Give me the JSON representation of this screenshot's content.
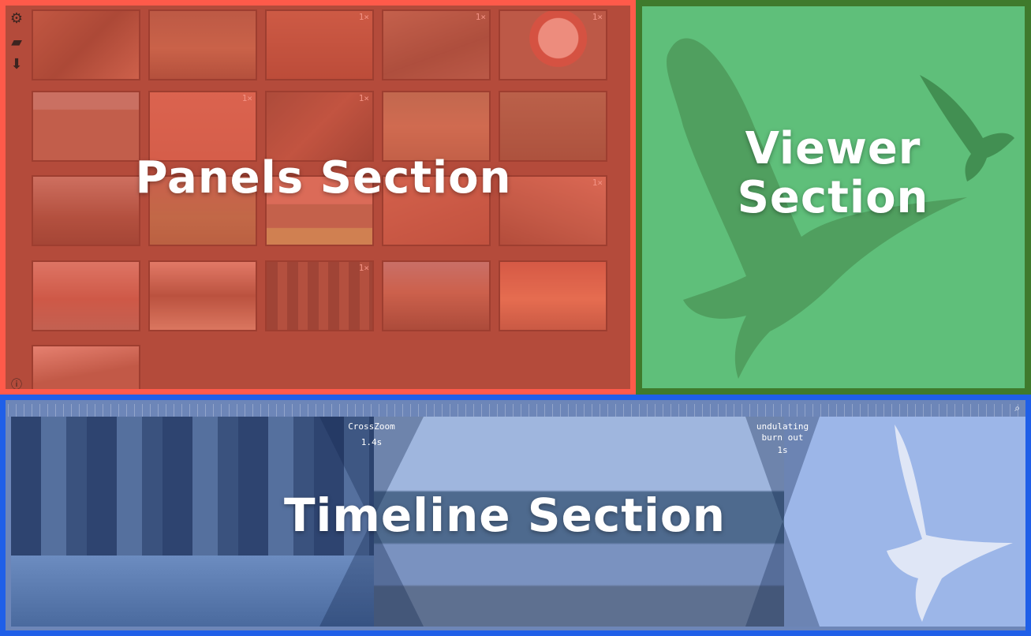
{
  "panels": {
    "label": "Panels Section",
    "tools": [
      "gear-icon",
      "folder-open-icon",
      "download-icon"
    ],
    "thumbnails": [
      {
        "rate": ""
      },
      {
        "rate": ""
      },
      {
        "rate": "1×"
      },
      {
        "rate": "1×"
      },
      {
        "rate": "1×"
      },
      {
        "rate": ""
      },
      {
        "rate": "1×"
      },
      {
        "rate": "1×"
      },
      {
        "rate": ""
      },
      {
        "rate": ""
      },
      {
        "rate": ""
      },
      {
        "rate": ""
      },
      {
        "rate": ""
      },
      {
        "rate": ""
      },
      {
        "rate": "1×"
      },
      {
        "rate": ""
      },
      {
        "rate": ""
      },
      {
        "rate": "1×"
      },
      {
        "rate": ""
      },
      {
        "rate": ""
      },
      {
        "rate": ""
      }
    ]
  },
  "viewer": {
    "label_line1": "Viewer",
    "label_line2": "Section"
  },
  "timeline": {
    "label": "Timeline Section",
    "transitions": [
      {
        "name": "CrossZoom",
        "duration": "1.4s"
      },
      {
        "name": "undulating burn out",
        "duration": "1s"
      }
    ]
  },
  "colors": {
    "panels_border": "#ff5a4a",
    "viewer_border": "#3f7a2c",
    "timeline_border": "#1f5fe8"
  }
}
